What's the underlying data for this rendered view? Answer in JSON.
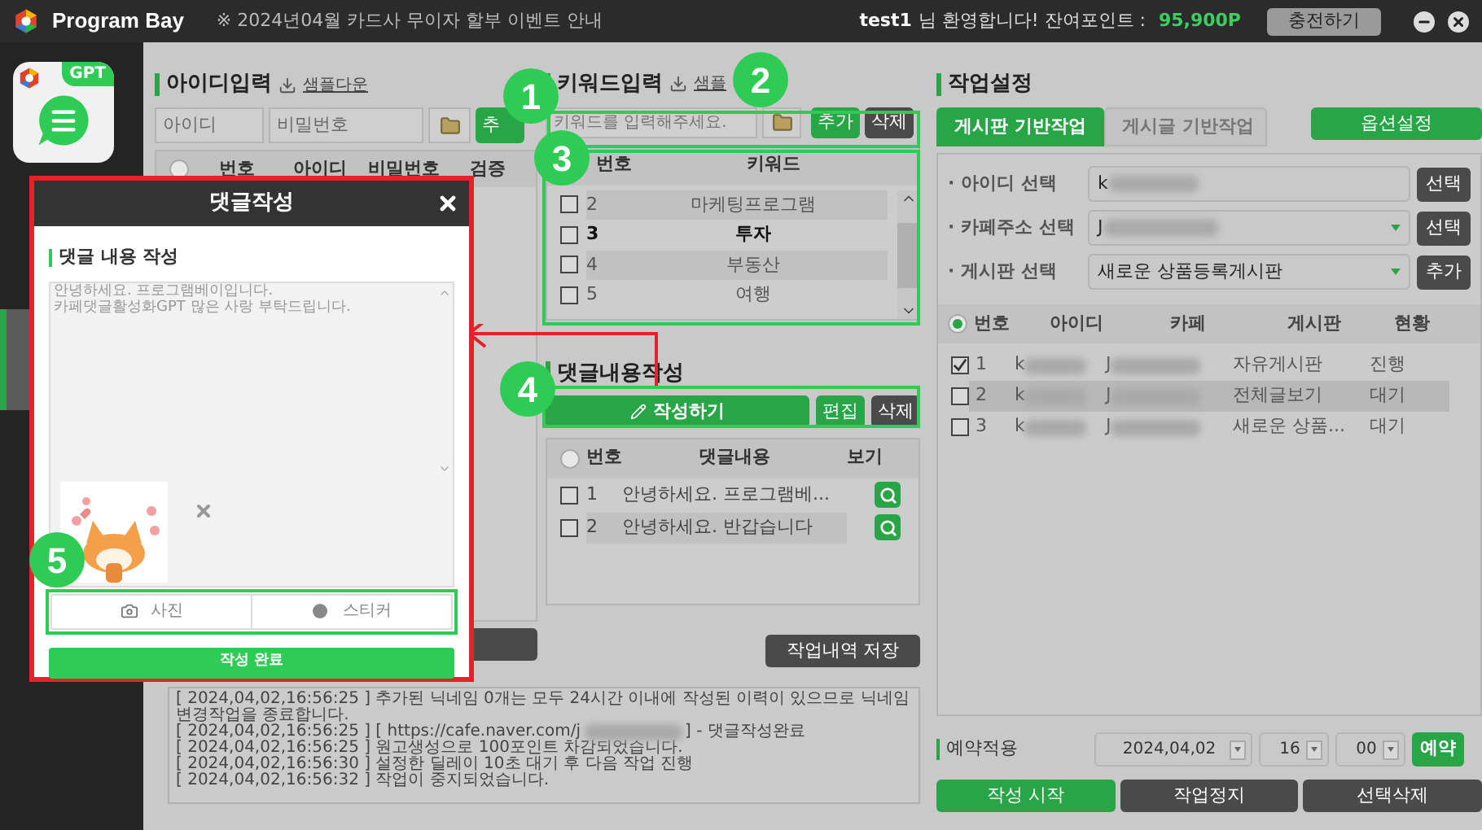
{
  "title_bar": {
    "app_name": "Program Bay",
    "notice": "※ 2024년04월 카드사 무이자 할부 이벤트 안내",
    "user": "test1",
    "greeting": "님 환영합니다! 잔여포인트 :",
    "points": "95,900P",
    "charge_button": "충전하기"
  },
  "sidebar": {
    "badge": "GPT"
  },
  "id_input": {
    "title": "아이디입력",
    "sample_link": "샘플다운",
    "id_placeholder": "아이디",
    "pw_placeholder": "비밀번호",
    "add_button": "추",
    "header_radio_selected": false,
    "columns": [
      "번호",
      "아이디",
      "비밀번호",
      "검증"
    ]
  },
  "keyword_input": {
    "title": "키워드입력",
    "sample_link": "샘플",
    "placeholder": "키워드를 입력해주세요.",
    "add_button": "추가",
    "delete_button": "삭제",
    "columns": [
      "번호",
      "키워드"
    ],
    "rows": [
      {
        "number": "2",
        "keyword": "마케팅프로그램",
        "checked": false,
        "shaded": true,
        "selected": false
      },
      {
        "number": "3",
        "keyword": "투자",
        "checked": false,
        "shaded": false,
        "selected": true
      },
      {
        "number": "4",
        "keyword": "부동산",
        "checked": false,
        "shaded": true,
        "selected": false
      },
      {
        "number": "5",
        "keyword": "여행",
        "checked": false,
        "shaded": false,
        "selected": false
      }
    ]
  },
  "comment_input": {
    "title": "댓글내용작성",
    "write_button": "작성하기",
    "edit_button": "편집",
    "delete_button": "삭제",
    "header_radio_selected": false,
    "columns": [
      "번호",
      "댓글내용",
      "보기"
    ],
    "rows": [
      {
        "number": "1",
        "content": "안녕하세요. 프로그램베...",
        "checked": false,
        "shaded": false
      },
      {
        "number": "2",
        "content": "안녕하세요. 반갑습니다",
        "checked": false,
        "shaded": true
      }
    ],
    "save_button": "작업내역 저장"
  },
  "log": [
    {
      "kind": "plain",
      "text": "[ 2024,04,02,16:56:25 ] 추가된 닉네임 0개는 모두 24시간 이내에 작성된 이력이 있으므로 닉네임변경작업을 종료합니다."
    },
    {
      "kind": "redacted",
      "text": "[ 2024,04,02,16:56:25 ] [ https://cafe.naver.com/j",
      "after": "] - 댓글작성완료"
    },
    {
      "kind": "plain",
      "text": "[ 2024,04,02,16:56:25 ] 원고생성으로 100포인트 차감되었습니다."
    },
    {
      "kind": "plain",
      "text": "[ 2024,04,02,16:56:30 ] 설정한 딜레이 10초 대기 후 다음 작업 진행"
    },
    {
      "kind": "plain",
      "text": "[ 2024,04,02,16:56:32 ] 작업이 중지되었습니다."
    }
  ],
  "work_settings": {
    "title": "작업설정",
    "tabs": [
      {
        "label": "게시판 기반작업",
        "selected": true
      },
      {
        "label": "게시글 기반작업",
        "selected": false
      }
    ],
    "option_button": "옵션설정",
    "fields": [
      {
        "label": "· 아이디 선택",
        "value": "k",
        "dropdown": false,
        "button": "선택"
      },
      {
        "label": "· 카페주소 선택",
        "value": "J",
        "dropdown": true,
        "button": "선택"
      },
      {
        "label": "· 게시판 선택",
        "value": "새로운 상품등록게시판",
        "dropdown": true,
        "button": "추가"
      }
    ],
    "header_radio_selected": true,
    "columns": [
      "번호",
      "아이디",
      "카페",
      "게시판",
      "현황"
    ],
    "rows": [
      {
        "number": "1",
        "id": "k",
        "cafe": "J",
        "board": "자유게시판",
        "status": "진행",
        "checked": true,
        "shaded": false
      },
      {
        "number": "2",
        "id": "k",
        "cafe": "J",
        "board": "전체글보기",
        "status": "대기",
        "checked": false,
        "shaded": true
      },
      {
        "number": "3",
        "id": "k",
        "cafe": "J",
        "board": "새로운 상품...",
        "status": "대기",
        "checked": false,
        "shaded": false
      }
    ],
    "reservation": {
      "label": "예약적용",
      "date": "2024,04,02",
      "hour": "16",
      "minute": "00",
      "button": "예약"
    },
    "actions": [
      {
        "label": "작성 시작",
        "kind": "primary"
      },
      {
        "label": "작업정지",
        "kind": "dark"
      },
      {
        "label": "선택삭제",
        "kind": "dark"
      }
    ]
  },
  "dialog": {
    "title": "댓글작성",
    "section": "댓글 내용 작성",
    "text": "안녕하세요. 프로그램베이입니다.\n카페댓글활성화GPT 많은 사랑 부탁드립니다.",
    "tabs": [
      "사진",
      "스티커"
    ],
    "submit": "작성 완료"
  },
  "annotations": [
    {
      "label": "1"
    },
    {
      "label": "2"
    },
    {
      "label": "3"
    },
    {
      "label": "4"
    },
    {
      "label": "5"
    }
  ]
}
